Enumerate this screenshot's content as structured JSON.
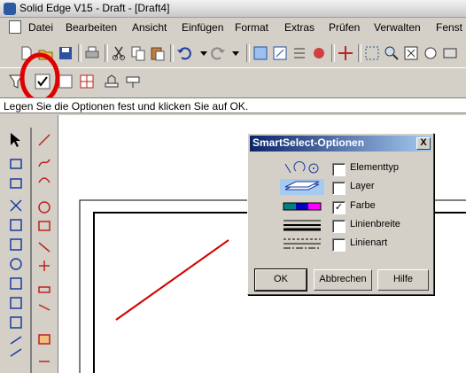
{
  "window": {
    "title": "Solid Edge V15 - Draft - [Draft4]"
  },
  "menu": [
    "Datei",
    "Bearbeiten",
    "Ansicht",
    "Einfügen",
    "Format",
    "Extras",
    "Prüfen",
    "Verwalten",
    "Fenst"
  ],
  "prompt": "Legen Sie die Optionen fest und klicken Sie auf OK.",
  "dialog": {
    "title": "SmartSelect-Optionen",
    "close": "X",
    "options": [
      {
        "label": "Elementtyp",
        "checked": false,
        "mark": ""
      },
      {
        "label": "Layer",
        "checked": false,
        "mark": ""
      },
      {
        "label": "Farbe",
        "checked": true,
        "mark": "✓"
      },
      {
        "label": "Linienbreite",
        "checked": false,
        "mark": ""
      },
      {
        "label": "Linienart",
        "checked": false,
        "mark": ""
      }
    ],
    "buttons": {
      "ok": "OK",
      "cancel": "Abbrechen",
      "help": "Hilfe"
    }
  },
  "colors": {
    "annotation_red": "#e00000",
    "drawn_line": "#d40000",
    "title_blue": "#0a246a"
  },
  "icons": [
    "document-icon",
    "open-icon",
    "save-icon",
    "print-icon",
    "cut-icon",
    "copy-icon",
    "paste-icon",
    "undo-icon",
    "redo-icon",
    "filter-icon",
    "smartselect-icon"
  ]
}
